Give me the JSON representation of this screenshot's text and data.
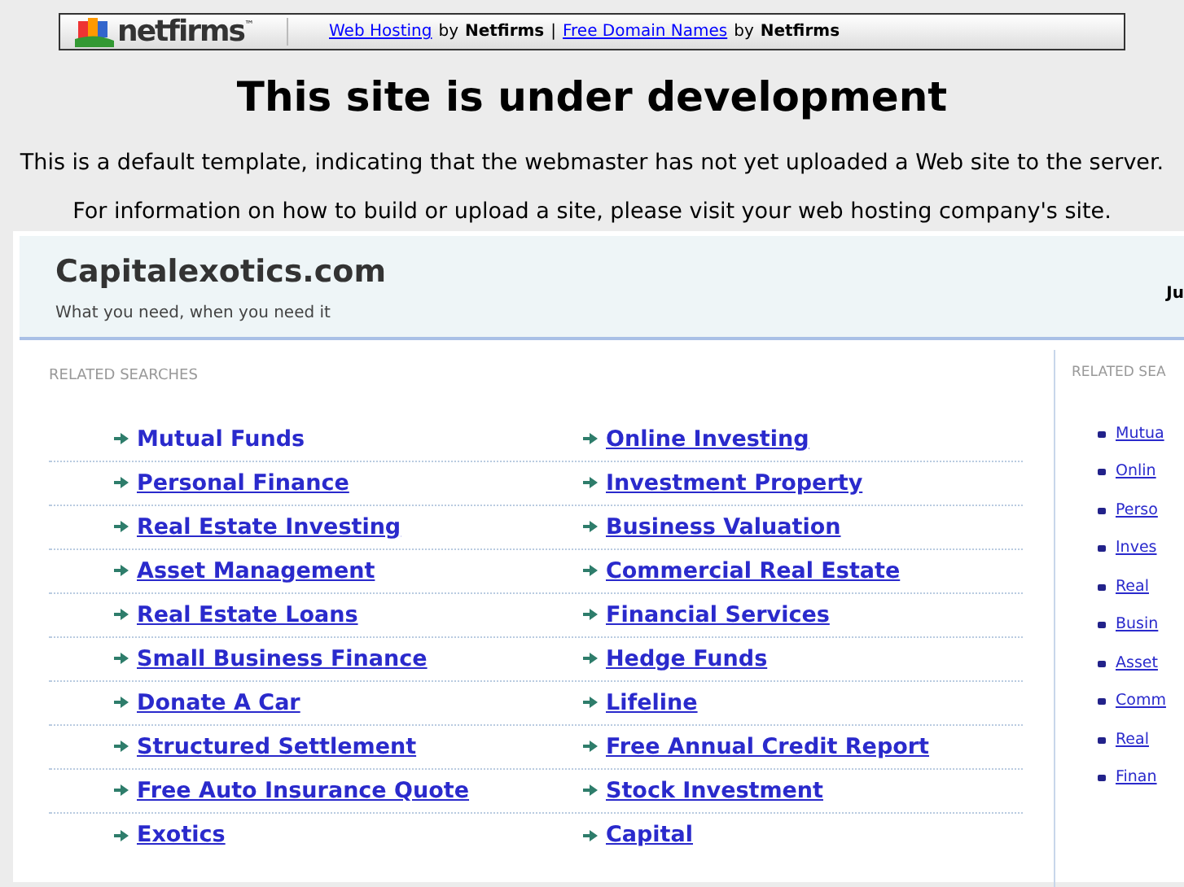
{
  "top_bar": {
    "logo_text": "netfirms",
    "logo_mark": "™",
    "segments": [
      {
        "kind": "link",
        "text": "Web Hosting"
      },
      {
        "kind": "text",
        "text": "by"
      },
      {
        "kind": "bold",
        "text": "Netfirms"
      },
      {
        "kind": "text",
        "text": "|"
      },
      {
        "kind": "link",
        "text": "Free Domain Names"
      },
      {
        "kind": "text",
        "text": "by"
      },
      {
        "kind": "bold",
        "text": "Netfirms"
      }
    ]
  },
  "heading": "This site is under development",
  "paragraphs": [
    "This is a default template, indicating that the webmaster has not yet uploaded a Web site to the server.",
    "For information on how to build or upload a site, please visit your web hosting company's site."
  ],
  "site": {
    "title": "Capitalexotics.com",
    "tagline": "What you need, when you need it",
    "corner_text": "Ju"
  },
  "main": {
    "heading": "RELATED SEARCHES",
    "rows": [
      [
        {
          "text": "Mutual Funds",
          "hovered": true
        },
        {
          "text": "Online Investing",
          "hovered": false
        }
      ],
      [
        {
          "text": "Personal Finance",
          "hovered": false
        },
        {
          "text": "Investment Property",
          "hovered": false
        }
      ],
      [
        {
          "text": "Real Estate Investing",
          "hovered": false
        },
        {
          "text": "Business Valuation",
          "hovered": false
        }
      ],
      [
        {
          "text": "Asset Management",
          "hovered": false
        },
        {
          "text": "Commercial Real Estate",
          "hovered": false
        }
      ],
      [
        {
          "text": "Real Estate Loans",
          "hovered": false
        },
        {
          "text": "Financial Services",
          "hovered": false
        }
      ],
      [
        {
          "text": "Small Business Finance",
          "hovered": false
        },
        {
          "text": "Hedge Funds",
          "hovered": false
        }
      ],
      [
        {
          "text": "Donate A Car",
          "hovered": false
        },
        {
          "text": "Lifeline",
          "hovered": false
        }
      ],
      [
        {
          "text": "Structured Settlement",
          "hovered": false
        },
        {
          "text": "Free Annual Credit Report",
          "hovered": false
        }
      ],
      [
        {
          "text": "Free Auto Insurance Quote",
          "hovered": false
        },
        {
          "text": "Stock Investment",
          "hovered": false
        }
      ],
      [
        {
          "text": "Exotics",
          "hovered": false
        },
        {
          "text": "Capital",
          "hovered": false
        }
      ]
    ]
  },
  "side": {
    "heading": "RELATED SEA",
    "links": [
      "Mutua",
      "Onlin",
      "Perso",
      "Inves",
      "Real",
      "Busin",
      "Asset",
      "Comm",
      "Real",
      "Finan"
    ]
  }
}
